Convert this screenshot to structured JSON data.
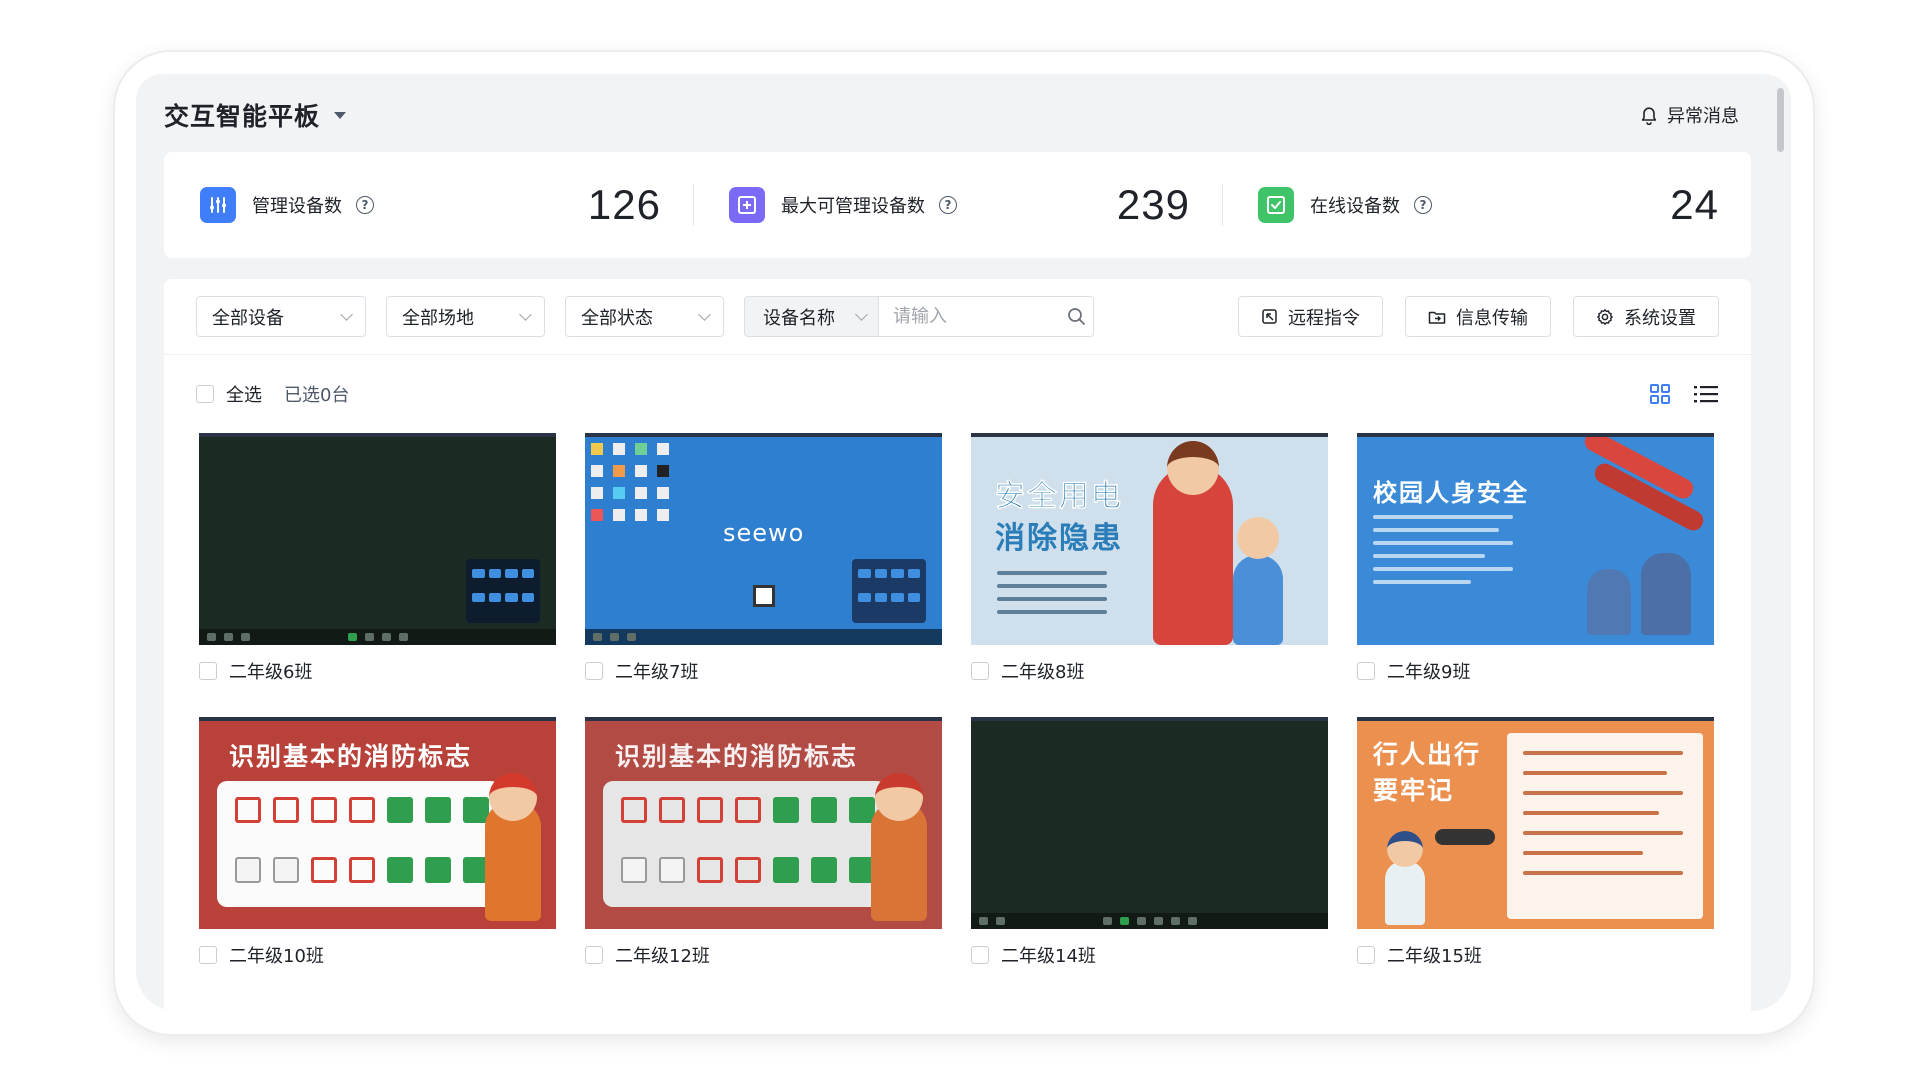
{
  "app": {
    "title": "交互智能平板",
    "alert_label": "异常消息"
  },
  "stats": [
    {
      "label": "管理设备数",
      "value": "126",
      "color": "#3f7ef8"
    },
    {
      "label": "最大可管理设备数",
      "value": "239",
      "color": "#7a6af6"
    },
    {
      "label": "在线设备数",
      "value": "24",
      "color": "#3fc46a"
    }
  ],
  "filters": {
    "device": "全部设备",
    "venue": "全部场地",
    "status": "全部状态",
    "search_type": "设备名称",
    "search_placeholder": "请输入"
  },
  "actions": {
    "remote": "远程指令",
    "transfer": "信息传输",
    "settings": "系统设置"
  },
  "selection": {
    "select_all": "全选",
    "selected": "已选0台"
  },
  "devices": [
    {
      "name": "二年级6班",
      "screen": "dark-desktop"
    },
    {
      "name": "二年级7班",
      "screen": "seewo-desktop",
      "logo": "seewo"
    },
    {
      "name": "二年级8班",
      "screen": "electricity-safety",
      "title_1": "安全用电",
      "title_2": "消除隐患"
    },
    {
      "name": "二年级9班",
      "screen": "campus-safety",
      "title_1": "校园人身安全"
    },
    {
      "name": "二年级10班",
      "screen": "fire-signs",
      "title_1": "识别基本的消防标志"
    },
    {
      "name": "二年级12班",
      "screen": "fire-signs",
      "title_1": "识别基本的消防标志"
    },
    {
      "name": "二年级14班",
      "screen": "dark-desktop"
    },
    {
      "name": "二年级15班",
      "screen": "pedestrian-safety",
      "title_1": "行人出行",
      "title_2": "要牢记"
    }
  ],
  "accent": "#3f7ef8"
}
